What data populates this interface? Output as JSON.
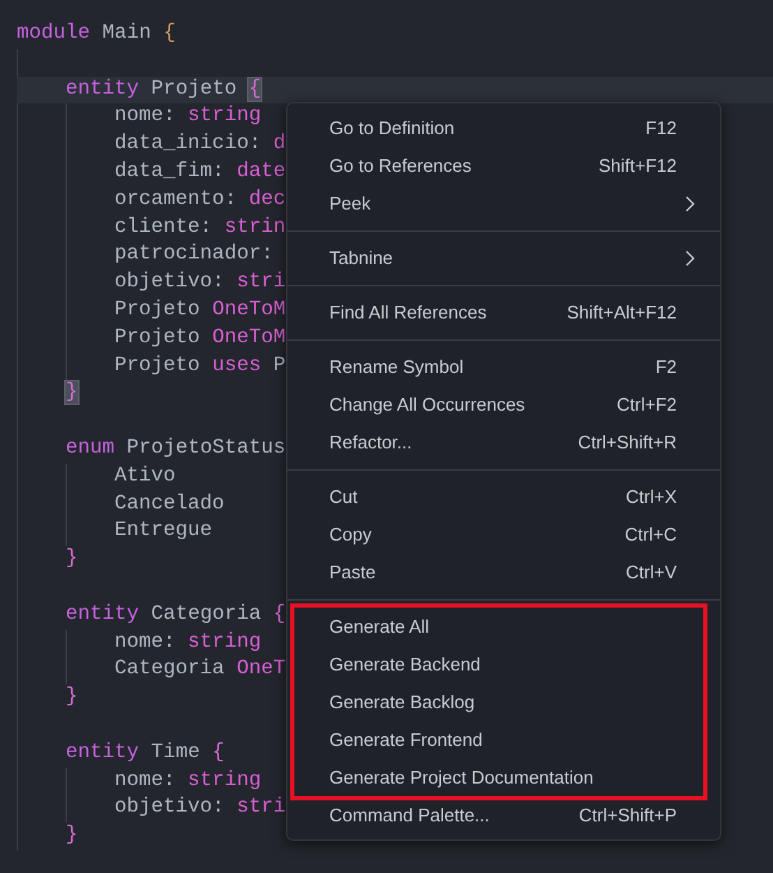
{
  "code": {
    "lines": [
      {
        "kind": "code",
        "tokens": [
          {
            "text": "module",
            "kind": "keyword"
          },
          {
            "text": " Main ",
            "kind": "plain"
          },
          {
            "text": "{",
            "kind": "brace"
          }
        ],
        "children": [
          {
            "kind": "blank"
          },
          {
            "kind": "code",
            "current": true,
            "tokens": [
              {
                "text": "entity",
                "kind": "keyword"
              },
              {
                "text": " Projeto ",
                "kind": "plain"
              },
              {
                "text": "{",
                "kind": "brace",
                "matched": true
              }
            ],
            "children": [
              {
                "kind": "code",
                "tokens": [
                  {
                    "text": "nome: ",
                    "kind": "plain"
                  },
                  {
                    "text": "string",
                    "kind": "type"
                  }
                ]
              },
              {
                "kind": "code",
                "tokens": [
                  {
                    "text": "data_inicio: ",
                    "kind": "plain"
                  },
                  {
                    "text": "d",
                    "kind": "type"
                  }
                ]
              },
              {
                "kind": "code",
                "tokens": [
                  {
                    "text": "data_fim: ",
                    "kind": "plain"
                  },
                  {
                    "text": "date",
                    "kind": "type"
                  }
                ]
              },
              {
                "kind": "code",
                "tokens": [
                  {
                    "text": "orcamento: ",
                    "kind": "plain"
                  },
                  {
                    "text": "dec",
                    "kind": "type"
                  }
                ]
              },
              {
                "kind": "code",
                "tokens": [
                  {
                    "text": "cliente: ",
                    "kind": "plain"
                  },
                  {
                    "text": "strin",
                    "kind": "type"
                  }
                ]
              },
              {
                "kind": "code",
                "tokens": [
                  {
                    "text": "patrocinador:",
                    "kind": "plain"
                  }
                ]
              },
              {
                "kind": "code",
                "tokens": [
                  {
                    "text": "objetivo: ",
                    "kind": "plain"
                  },
                  {
                    "text": "stri",
                    "kind": "type"
                  }
                ]
              },
              {
                "kind": "code",
                "tokens": [
                  {
                    "text": "Projeto ",
                    "kind": "plain"
                  },
                  {
                    "text": "OneToM",
                    "kind": "type"
                  }
                ]
              },
              {
                "kind": "code",
                "tokens": [
                  {
                    "text": "Projeto ",
                    "kind": "plain"
                  },
                  {
                    "text": "OneToM",
                    "kind": "type"
                  }
                ]
              },
              {
                "kind": "code",
                "tokens": [
                  {
                    "text": "Projeto ",
                    "kind": "plain"
                  },
                  {
                    "text": "uses",
                    "kind": "type"
                  },
                  {
                    "text": " P",
                    "kind": "plain"
                  }
                ]
              }
            ]
          },
          {
            "kind": "code",
            "tokens": [
              {
                "text": "}",
                "kind": "brace",
                "matched": true
              }
            ]
          },
          {
            "kind": "blank"
          },
          {
            "kind": "code",
            "tokens": [
              {
                "text": "enum",
                "kind": "keyword"
              },
              {
                "text": " ProjetoStatus",
                "kind": "plain"
              }
            ],
            "children": [
              {
                "kind": "code",
                "tokens": [
                  {
                    "text": "Ativo",
                    "kind": "plain"
                  }
                ]
              },
              {
                "kind": "code",
                "tokens": [
                  {
                    "text": "Cancelado",
                    "kind": "plain"
                  }
                ]
              },
              {
                "kind": "code",
                "tokens": [
                  {
                    "text": "Entregue",
                    "kind": "plain"
                  }
                ]
              }
            ]
          },
          {
            "kind": "code",
            "tokens": [
              {
                "text": "}",
                "kind": "brace"
              }
            ]
          },
          {
            "kind": "blank"
          },
          {
            "kind": "code",
            "tokens": [
              {
                "text": "entity",
                "kind": "keyword"
              },
              {
                "text": " Categoria ",
                "kind": "plain"
              },
              {
                "text": "{",
                "kind": "brace"
              }
            ],
            "children": [
              {
                "kind": "code",
                "tokens": [
                  {
                    "text": "nome: ",
                    "kind": "plain"
                  },
                  {
                    "text": "string",
                    "kind": "type"
                  }
                ]
              },
              {
                "kind": "code",
                "tokens": [
                  {
                    "text": "Categoria ",
                    "kind": "plain"
                  },
                  {
                    "text": "OneT",
                    "kind": "type"
                  }
                ]
              }
            ]
          },
          {
            "kind": "code",
            "tokens": [
              {
                "text": "}",
                "kind": "brace"
              }
            ]
          },
          {
            "kind": "blank"
          },
          {
            "kind": "code",
            "tokens": [
              {
                "text": "entity",
                "kind": "keyword"
              },
              {
                "text": " Time ",
                "kind": "plain"
              },
              {
                "text": "{",
                "kind": "brace"
              }
            ],
            "children": [
              {
                "kind": "code",
                "tokens": [
                  {
                    "text": "nome: ",
                    "kind": "plain"
                  },
                  {
                    "text": "string",
                    "kind": "type"
                  }
                ]
              },
              {
                "kind": "code",
                "tokens": [
                  {
                    "text": "objetivo: ",
                    "kind": "plain"
                  },
                  {
                    "text": "stri",
                    "kind": "type"
                  }
                ]
              }
            ]
          },
          {
            "kind": "code",
            "tokens": [
              {
                "text": "}",
                "kind": "brace"
              }
            ]
          }
        ]
      }
    ]
  },
  "context_menu": {
    "sections": [
      {
        "items": [
          {
            "label": "Go to Definition",
            "shortcut": "F12"
          },
          {
            "label": "Go to References",
            "shortcut": "Shift+F12"
          },
          {
            "label": "Peek",
            "submenu": true
          }
        ]
      },
      {
        "items": [
          {
            "label": "Tabnine",
            "submenu": true
          }
        ]
      },
      {
        "items": [
          {
            "label": "Find All References",
            "shortcut": "Shift+Alt+F12"
          }
        ]
      },
      {
        "items": [
          {
            "label": "Rename Symbol",
            "shortcut": "F2"
          },
          {
            "label": "Change All Occurrences",
            "shortcut": "Ctrl+F2"
          },
          {
            "label": "Refactor...",
            "shortcut": "Ctrl+Shift+R"
          }
        ]
      },
      {
        "items": [
          {
            "label": "Cut",
            "shortcut": "Ctrl+X"
          },
          {
            "label": "Copy",
            "shortcut": "Ctrl+C"
          },
          {
            "label": "Paste",
            "shortcut": "Ctrl+V"
          }
        ]
      },
      {
        "items": [
          {
            "label": "Generate All",
            "outlined": true
          },
          {
            "label": "Generate Backend",
            "outlined": true
          },
          {
            "label": "Generate Backlog",
            "outlined": true
          },
          {
            "label": "Generate Frontend",
            "outlined": true
          },
          {
            "label": "Generate Project Documentation",
            "outlined": true
          },
          {
            "label": "Command Palette...",
            "shortcut": "Ctrl+Shift+P"
          }
        ]
      }
    ]
  }
}
